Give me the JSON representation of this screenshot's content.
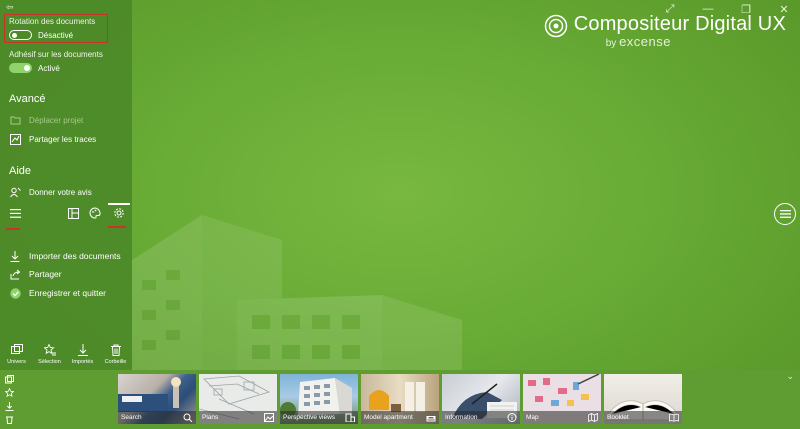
{
  "window": {
    "controls": [
      "⤢",
      "—",
      "❐",
      "✕"
    ]
  },
  "brand": {
    "title": "Compositeur Digital UX",
    "by": "by",
    "company": "excense"
  },
  "settings": {
    "rotation": {
      "label": "Rotation des documents",
      "state": "Désactivé",
      "enabled": false
    },
    "adhesif": {
      "label": "Adhésif sur les documents",
      "state": "Activé",
      "enabled": true
    }
  },
  "avance": {
    "title": "Avancé",
    "items": [
      {
        "label": "Déplacer projet",
        "icon": "move-folder-icon",
        "disabled": true
      },
      {
        "label": "Partager les traces",
        "icon": "share-traces-icon",
        "disabled": false
      }
    ]
  },
  "aide": {
    "title": "Aide",
    "items": [
      {
        "label": "Donner votre avis",
        "icon": "feedback-icon"
      }
    ]
  },
  "actions": [
    {
      "label": "Importer des documents",
      "icon": "download-icon"
    },
    {
      "label": "Partager",
      "icon": "share-icon"
    },
    {
      "label": "Enregistrer et quitter",
      "icon": "check-circle-icon"
    }
  ],
  "bottom_tabs": [
    {
      "label": "Univers",
      "icon": "universe-icon"
    },
    {
      "label": "Sélection",
      "icon": "star-list-icon"
    },
    {
      "label": "Importés",
      "icon": "import-icon"
    },
    {
      "label": "Corbeille",
      "icon": "trash-icon"
    }
  ],
  "tiles": [
    {
      "label": "Search",
      "icon": "search-icon"
    },
    {
      "label": "Plans",
      "icon": "image-icon"
    },
    {
      "label": "Perspective views",
      "icon": "building-icon"
    },
    {
      "label": "Model apartment",
      "icon": "sofa-icon"
    },
    {
      "label": "Information",
      "icon": "info-icon"
    },
    {
      "label": "Map",
      "icon": "map-icon"
    },
    {
      "label": "Booklet",
      "icon": "book-icon"
    }
  ],
  "colors": {
    "accent_red": "#c8332b",
    "toggle_on": "#8fd36a",
    "background": "#6cae38"
  }
}
